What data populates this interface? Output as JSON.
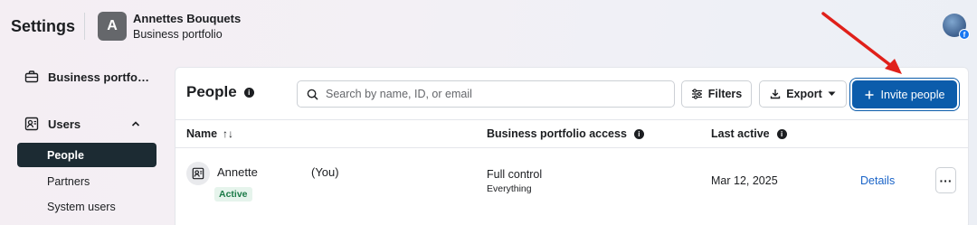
{
  "header": {
    "title": "Settings",
    "account_initial": "A",
    "account_name": "Annettes Bouquets",
    "account_type": "Business portfolio",
    "profile_badge": "f"
  },
  "sidebar": {
    "business_portfolio": "Business portfo…",
    "users": "Users",
    "sub_items": [
      "People",
      "Partners",
      "System users"
    ],
    "active": "People"
  },
  "main": {
    "title": "People",
    "info_glyph": "i",
    "search": {
      "placeholder": "Search by name, ID, or email",
      "value": ""
    },
    "buttons": {
      "filters": "Filters",
      "export": "Export",
      "invite": "Invite people"
    },
    "columns": {
      "name": "Name",
      "access": "Business portfolio access",
      "last_active": "Last active"
    },
    "rows": [
      {
        "name": "Annette",
        "you": "(You)",
        "status": "Active",
        "access": "Full control",
        "access_detail": "Everything",
        "last_active": "Mar 12, 2025",
        "details": "Details"
      }
    ]
  },
  "colors": {
    "primary": "#0b5cab",
    "status_active": "#1b7a47",
    "link": "#1a64c8",
    "sidebar_active": "#1c2b33",
    "annotation": "#e0201a"
  }
}
